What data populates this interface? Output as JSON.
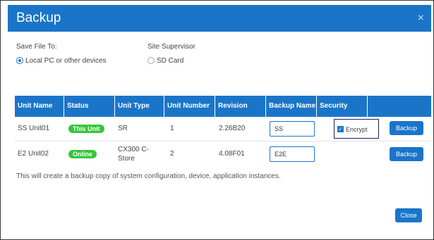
{
  "dialog": {
    "title": "Backup",
    "close_glyph": "×"
  },
  "save_file_to": {
    "label": "Save File To:",
    "option_label": "Local PC or other devices",
    "selected": true
  },
  "site_supervisor": {
    "label": "Site Supervisor",
    "option_label": "SD Card",
    "selected": false
  },
  "table": {
    "headers": [
      "Unit Name",
      "Status",
      "Unit Type",
      "Unit Number",
      "Revision",
      "Backup Name",
      "Security",
      ""
    ],
    "rows": [
      {
        "unit_name": "SS Unit01",
        "status": "This Unit",
        "unit_type": "SR",
        "unit_number": "1",
        "revision": "2.26B20",
        "backup_name": "SS",
        "security_label": "Encrypt",
        "security_checked": true,
        "action": "Backup"
      },
      {
        "unit_name": "E2 Unit02",
        "status": "Online",
        "unit_type": "CX300 C-Store",
        "unit_number": "2",
        "revision": "4.08F01",
        "backup_name": "E2E",
        "action": "Backup"
      }
    ]
  },
  "note": "This will create a backup copy of system configuration, device, application instances.",
  "footer": {
    "close_label": "Close"
  },
  "colors": {
    "accent": "#1a75c9",
    "status_green": "#36c53a"
  }
}
